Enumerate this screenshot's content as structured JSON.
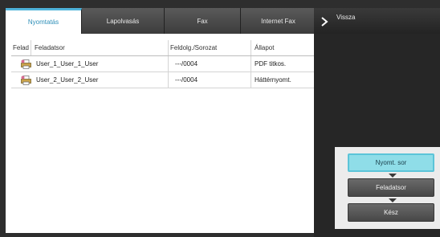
{
  "tabs": [
    {
      "label": "Nyomtatás",
      "active": true
    },
    {
      "label": "Lapolvasás",
      "active": false
    },
    {
      "label": "Fax",
      "active": false
    },
    {
      "label": "Internet Fax",
      "active": false
    }
  ],
  "back": {
    "label": "Vissza"
  },
  "table": {
    "headers": [
      "Felad",
      "Feladatsor",
      "Feldolg./Sorozat",
      "Állapot"
    ],
    "rows": [
      {
        "name": "User_1_User_1_User",
        "progress": "---/0004",
        "status": "PDF titkos."
      },
      {
        "name": "User_2_User_2_User",
        "progress": "---/0004",
        "status": "Háttérnyomt."
      }
    ]
  },
  "side_buttons": {
    "print_queue": "Nyomt. sor",
    "job_queue": "Feladatsor",
    "done": "Kész"
  },
  "colors": {
    "accent": "#4fb3d9",
    "selected_button": "#8fdde8",
    "panel_dark": "#262626"
  }
}
